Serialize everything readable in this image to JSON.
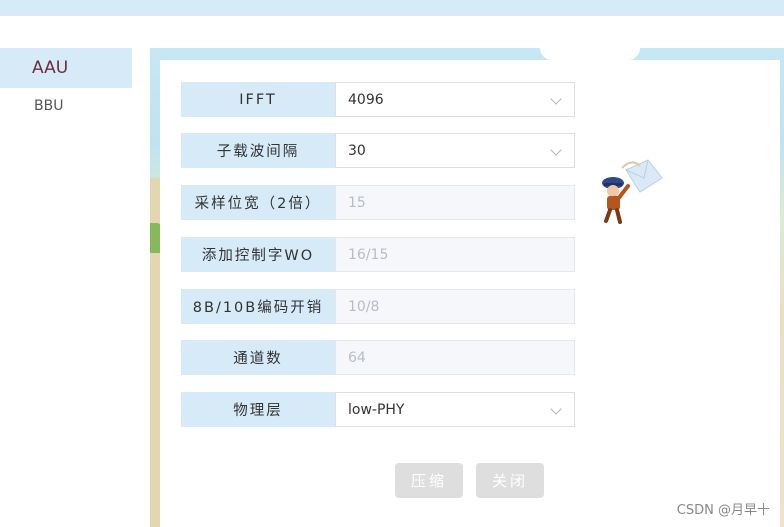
{
  "sidebar": {
    "items": [
      {
        "label": "AAU",
        "active": true
      },
      {
        "label": "BBU",
        "active": false
      }
    ]
  },
  "form": {
    "rows": [
      {
        "label": "IFFT",
        "value": "4096",
        "type": "select"
      },
      {
        "label": "子载波间隔",
        "value": "30",
        "type": "select"
      },
      {
        "label": "采样位宽（2倍）",
        "value": "15",
        "type": "disabled"
      },
      {
        "label": "添加控制字WO",
        "value": "16/15",
        "type": "disabled"
      },
      {
        "label": "8B/10B编码开销",
        "value": "10/8",
        "type": "disabled"
      },
      {
        "label": "通道数",
        "value": "64",
        "type": "disabled"
      },
      {
        "label": "物理层",
        "value": "low-PHY",
        "type": "select"
      }
    ]
  },
  "buttons": {
    "compress": "压缩",
    "close": "关闭"
  },
  "watermark": "CSDN @月早十",
  "icons": {
    "mascot": "mail-courier-mascot",
    "select_arrow": "chevron-down-icon"
  },
  "colors": {
    "accent_bg": "#d6eaf8",
    "active_text": "#6b2e3e",
    "button_disabled": "#dedede"
  }
}
